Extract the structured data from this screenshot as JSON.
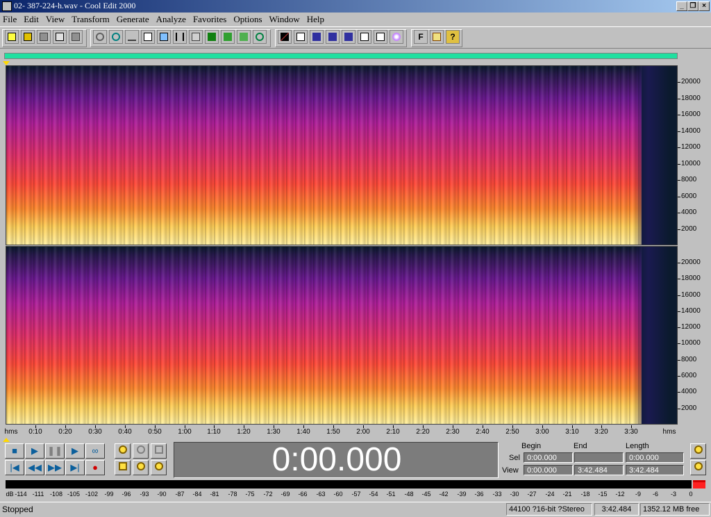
{
  "window": {
    "title": "02- 387-224-h.wav - Cool Edit 2000",
    "minimize_glyph": "_",
    "restore_glyph": "❐",
    "close_glyph": "×"
  },
  "menu": [
    "File",
    "Edit",
    "View",
    "Transform",
    "Generate",
    "Analyze",
    "Favorites",
    "Options",
    "Window",
    "Help"
  ],
  "toolbar": {
    "file_icons": [
      "new-file-icon",
      "open-folder-icon",
      "save-icon",
      "save-all-icon",
      "save-selection-icon"
    ],
    "edit_icons": [
      "undo-icon",
      "loop-icon",
      "scissors-curve-icon",
      "copy-frame-icon",
      "paste-icon",
      "cut-icon",
      "mix-paste-icon",
      "waveform-icon",
      "spectral-icon",
      "save-arrow-icon"
    ],
    "view_icons": [
      "spectral-view-icon",
      "frame-icon",
      "grid-view-1-icon",
      "grid-view-2-icon",
      "grid-view-3-icon",
      "document-icon",
      "text-document-icon",
      "cd-icon"
    ],
    "help_icons": [
      "f-icon",
      "script-icon",
      "help-icon"
    ],
    "f_label": "F",
    "help_label": "?"
  },
  "spectrogram": {
    "freq_labels": [
      "20000",
      "18000",
      "16000",
      "14000",
      "12000",
      "10000",
      "8000",
      "6000",
      "4000",
      "2000"
    ]
  },
  "time_ruler": {
    "unit_left": "hms",
    "unit_right": "hms",
    "labels": [
      "0:10",
      "0:20",
      "0:30",
      "0:40",
      "0:50",
      "1:00",
      "1:10",
      "1:20",
      "1:30",
      "1:40",
      "1:50",
      "2:00",
      "2:10",
      "2:20",
      "2:30",
      "2:40",
      "2:50",
      "3:00",
      "3:10",
      "3:20",
      "3:30"
    ]
  },
  "transport": {
    "stop": "■",
    "play": "▶",
    "pause": "❚❚",
    "play_to_end": "▶",
    "loop": "∞",
    "go_start": "|◀",
    "rewind": "◀◀",
    "fast_forward": "▶▶",
    "go_end": "▶|",
    "record": "●"
  },
  "time_display": "0:00.000",
  "selection": {
    "begin_header": "Begin",
    "end_header": "End",
    "length_header": "Length",
    "sel_label": "Sel",
    "view_label": "View",
    "sel_begin": "0:00.000",
    "sel_end": "",
    "sel_length": "0:00.000",
    "view_begin": "0:00.000",
    "view_end": "3:42.484",
    "view_length": "3:42.484"
  },
  "db_scale": {
    "unit": "dB",
    "labels": [
      "-114",
      "-111",
      "-108",
      "-105",
      "-102",
      "-99",
      "-96",
      "-93",
      "-90",
      "-87",
      "-84",
      "-81",
      "-78",
      "-75",
      "-72",
      "-69",
      "-66",
      "-63",
      "-60",
      "-57",
      "-54",
      "-51",
      "-48",
      "-45",
      "-42",
      "-39",
      "-36",
      "-33",
      "-30",
      "-27",
      "-24",
      "-21",
      "-18",
      "-15",
      "-12",
      "-9",
      "-6",
      "-3",
      "0"
    ]
  },
  "status": {
    "state": "Stopped",
    "format": "44100 ?16-bit ?Stereo",
    "length": "3:42.484",
    "free_space": "1352.12 MB free"
  },
  "colors": {
    "overview": "#20e0a0",
    "spectro_low": "#ffe87a",
    "spectro_mid": "#ff3c5a",
    "spectro_high": "#c020b0",
    "spectro_bg": "#0b1a2e",
    "time_display_bg": "#7c7c7c"
  }
}
